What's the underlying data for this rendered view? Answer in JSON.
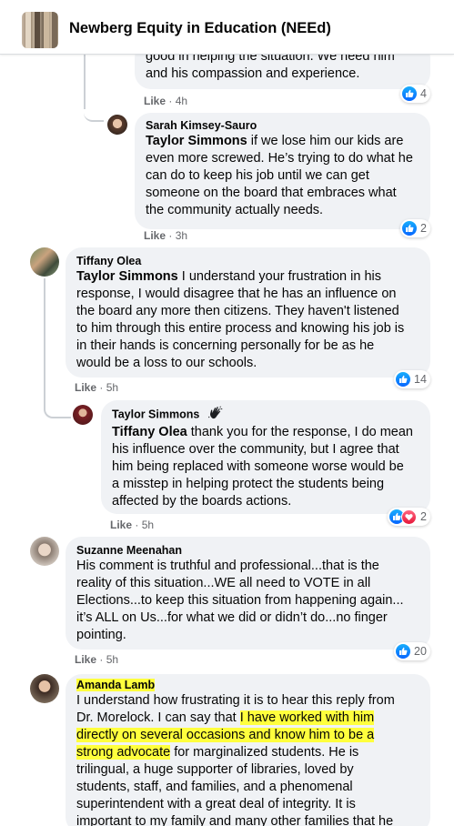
{
  "header": {
    "title": "Newberg Equity in Education (NEEd)"
  },
  "comments": [
    {
      "author": "",
      "tag": "",
      "text_lines": [
        "good in helping the situation. We need him",
        "and his compassion and experience."
      ],
      "like_label": "Like",
      "time": "4h",
      "reactions": "4"
    },
    {
      "author": "Sarah Kimsey-Sauro",
      "tag": "Taylor Simmons",
      "text_first_rest": " if we lose him our kids are",
      "text_lines": [
        "even more screwed. He’s trying to do what he",
        "can do to keep his job until we can get",
        "someone on the board that embraces what",
        "the community actually needs."
      ],
      "like_label": "Like",
      "time": "3h",
      "reactions": "2"
    },
    {
      "author": "Tiffany Olea",
      "tag": "Taylor Simmons",
      "text_first_rest": " I understand your frustration in his",
      "text_lines": [
        "response, I would disagree that he has an influence on",
        "the board any more then citizens. They haven't listened",
        "to him through this entire process and knowing his job is",
        "in their hands is concerning personally for be as he",
        "would be a loss to our schools."
      ],
      "like_label": "Like",
      "time": "5h",
      "reactions": "14"
    },
    {
      "author": "Taylor Simmons",
      "badge": "wave-hand-icon",
      "tag": "Tiffany Olea",
      "text_first_rest": " thank you for the response, I do mean",
      "text_lines": [
        "his influence over the community, but I agree that",
        "him being replaced with someone worse would be",
        "a misstep in helping protect the students being",
        "affected by the boards actions."
      ],
      "like_label": "Like",
      "time": "5h",
      "reactions": "2"
    },
    {
      "author": "Suzanne Meenahan",
      "text_lines": [
        "His comment is truthful and professional...that is the",
        "reality of this situation...WE all need to VOTE in all",
        "Elections...to keep this situation from happening again...",
        "it’s ALL on Us...for what we did or didn’t do...no finger",
        "pointing."
      ],
      "like_label": "Like",
      "time": "5h",
      "reactions": "20"
    },
    {
      "author": "Amanda Lamb",
      "l1": "I understand how frustrating it is to hear this reply from",
      "l2a": "Dr. Morelock. I can say that ",
      "l2b": "I have worked with him",
      "l3": "directly on several occasions and know him to be a",
      "l4a": "strong advocate",
      "l4b": " for marginalized students. He is",
      "text_lines": [
        "trilingual, a huge supporter of libraries, loved by",
        "students, staff, and families, and a phenomenal",
        "superintendent with a great deal of integrity. It is",
        "important to my family and many other families that he"
      ]
    }
  ],
  "colors": {
    "like_blue": "#0866ff",
    "bubble_bg": "#f0f2f5",
    "highlight": "#ffff3d",
    "meta_gray": "#65676b"
  }
}
